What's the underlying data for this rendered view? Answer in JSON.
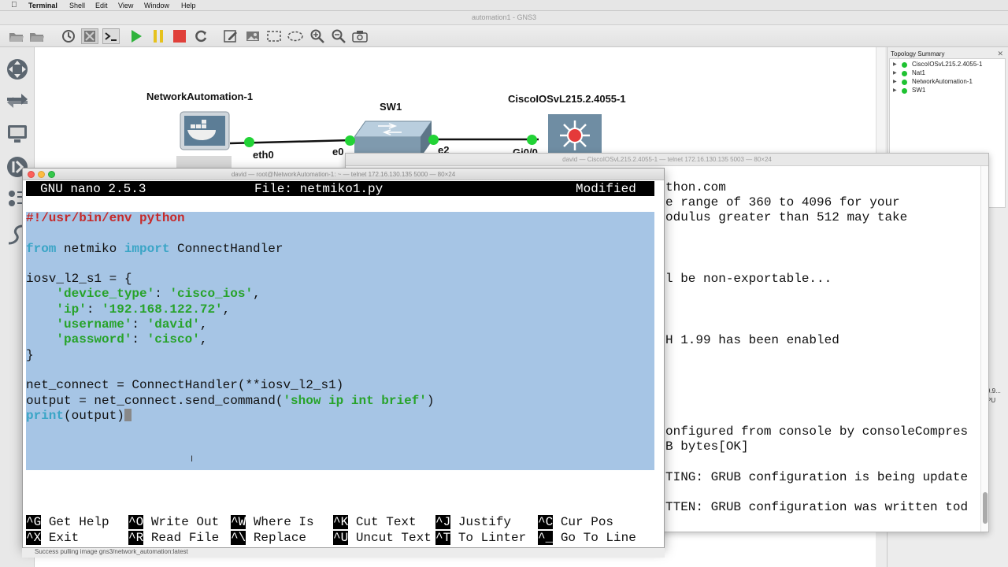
{
  "menubar": {
    "items": [
      "Terminal",
      "Shell",
      "Edit",
      "View",
      "Window",
      "Help"
    ]
  },
  "gns3": {
    "window_title": "automation1 - GNS3"
  },
  "topology": {
    "nodes": {
      "network_automation": "NetworkAutomation-1",
      "sw1": "SW1",
      "cisco": "CiscoIOSvL215.2.4055-1"
    },
    "ports": {
      "eth0": "eth0",
      "e0": "e0",
      "e2": "e2",
      "gi00": "Gi0/0"
    }
  },
  "topology_summary": {
    "header": "Topology Summary",
    "items": [
      "CiscoIOSvL215.2.4055-1",
      "Nat1",
      "NetworkAutomation-1",
      "SW1"
    ],
    "edge_texts": [
      "9.9...",
      "PU"
    ]
  },
  "terminal_back": {
    "title": "david — CiscoIOSvL215.2.4055-1 — telnet 172.16.130.135 5003 — 80×24",
    "lines": [
      "thon.com",
      "e range of 360 to 4096 for your",
      "odulus greater than 512 may take",
      "l be non-exportable...",
      "H 1.99 has been enabled",
      "onfigured from console by consoleCompres",
      "B bytes[OK]",
      "TING: GRUB configuration is being update",
      "TTEN: GRUB configuration was written tod"
    ]
  },
  "terminal_front": {
    "title": "david — root@NetworkAutomation-1: ~ — telnet 172.16.130.135 5000 — 80×24",
    "nano": {
      "version": "GNU nano 2.5.3",
      "file": "File: netmiko1.py",
      "status": "Modified"
    },
    "code": {
      "shebang_hash": "#!",
      "shebang_rest": "/usr/bin/env python",
      "from_kw": "from",
      "module": " netmiko ",
      "import_kw": "import",
      "imported": " ConnectHandler",
      "dict_open": "iosv_l2_s1 = {",
      "k_device_type": "'device_type'",
      "v_device_type": "'cisco_ios'",
      "k_ip": "'ip'",
      "v_ip": "'192.168.122.72'",
      "k_username": "'username'",
      "v_username": "'david'",
      "k_password": "'password'",
      "v_password": "'cisco'",
      "dict_close": "}",
      "net_connect": "net_connect = ConnectHandler(**iosv_l2_s1)",
      "output_prefix": "output = net_connect.send_command(",
      "output_arg": "'show ip int brief'",
      "output_suffix": ")",
      "print_kw": "print",
      "print_rest": "(output)"
    },
    "shortcuts": [
      {
        "key": "^G",
        "label": "Get Help"
      },
      {
        "key": "^O",
        "label": "Write Out"
      },
      {
        "key": "^W",
        "label": "Where Is"
      },
      {
        "key": "^K",
        "label": "Cut Text"
      },
      {
        "key": "^J",
        "label": "Justify"
      },
      {
        "key": "^C",
        "label": "Cur Pos"
      },
      {
        "key": "^X",
        "label": "Exit"
      },
      {
        "key": "^R",
        "label": "Read File"
      },
      {
        "key": "^\\",
        "label": "Replace"
      },
      {
        "key": "^U",
        "label": "Uncut Text"
      },
      {
        "key": "^T",
        "label": "To Linter"
      },
      {
        "key": "^_",
        "label": "Go To Line"
      }
    ]
  },
  "statusbar": {
    "text": "Success pulling image gns3/network_automation:latest"
  },
  "colors": {
    "link_dot": "#22d336",
    "selection": "#a6c5e5",
    "keyword": "#3aa5c6",
    "string": "#27a32a"
  }
}
